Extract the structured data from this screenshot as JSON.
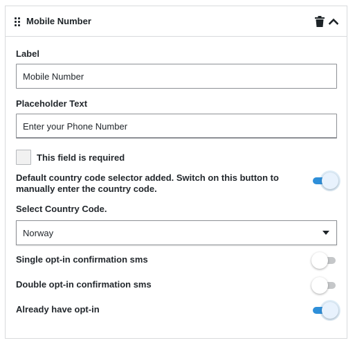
{
  "header": {
    "title": "Mobile Number",
    "icons": {
      "drag": "drag-handle-icon",
      "delete": "trash-icon",
      "collapse": "chevron-up-icon"
    }
  },
  "label_field": {
    "label": "Label",
    "value": "Mobile Number"
  },
  "placeholder_field": {
    "label": "Placeholder Text",
    "value": "Enter your Phone Number"
  },
  "required_checkbox": {
    "label": "This field is required",
    "checked": false
  },
  "country_code_toggle": {
    "label": "Default country code selector added. Switch on this button to manually enter the country code.",
    "on": true
  },
  "country_select": {
    "label": "Select Country Code.",
    "value": "Norway"
  },
  "single_optin_toggle": {
    "label": "Single opt-in confirmation sms",
    "on": false
  },
  "double_optin_toggle": {
    "label": "Double opt-in confirmation sms",
    "on": false
  },
  "already_optin_toggle": {
    "label": "Already have opt-in",
    "on": true
  },
  "colors": {
    "accent": "#2e8fd9",
    "border": "#8c8f94",
    "text": "#23282d"
  }
}
